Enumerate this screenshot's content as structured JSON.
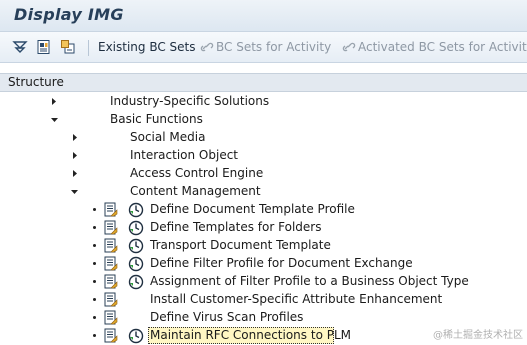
{
  "window": {
    "title": "Display IMG"
  },
  "toolbar": {
    "existing_bc_sets": "Existing BC Sets",
    "bc_sets_for_activity": "BC Sets for Activity",
    "activated_bc_sets_for_activity": "Activated BC Sets for Activity"
  },
  "tree_header": {
    "label": "Structure"
  },
  "tree": {
    "industry_specific": "Industry-Specific Solutions",
    "basic_functions": "Basic Functions",
    "social_media": "Social Media",
    "interaction_object": "Interaction Object",
    "access_control": "Access Control Engine",
    "content_management": "Content Management",
    "activities": [
      "Define Document Template Profile",
      "Define Templates for Folders",
      "Transport Document Template",
      "Define Filter Profile for Document Exchange",
      "Assignment of Filter Profile to a Business Object Type",
      "Install Customer-Specific Attribute Enhancement",
      "Define Virus Scan Profiles",
      "Maintain RFC Connections to PLM"
    ]
  },
  "watermark": "@稀土掘金技术社区"
}
